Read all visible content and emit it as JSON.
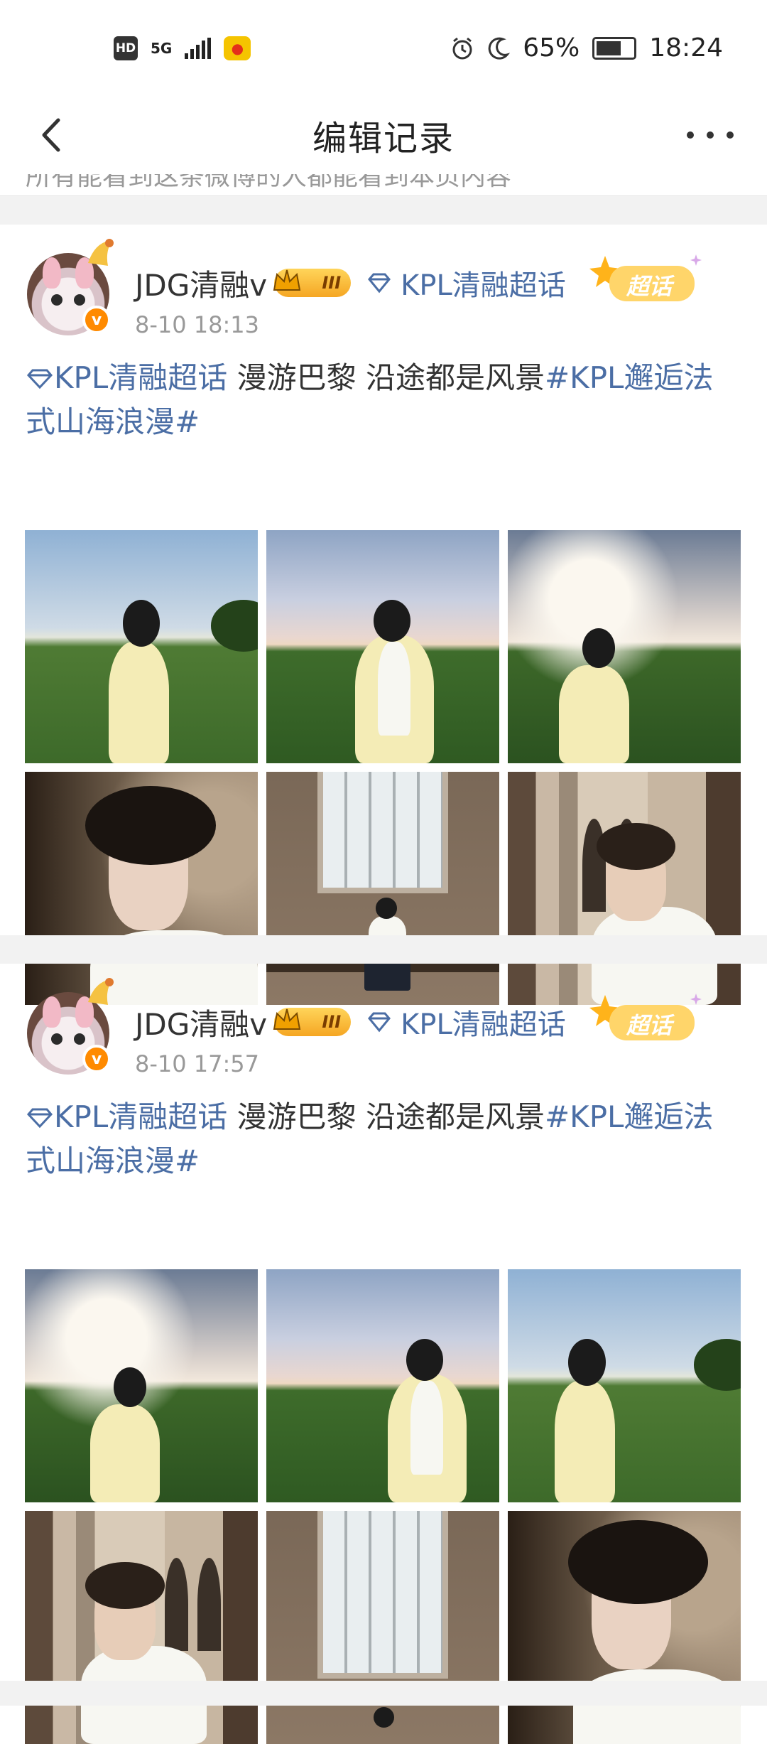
{
  "status": {
    "hd": "HD",
    "network": "5G",
    "battery": "65%",
    "time": "18:24"
  },
  "nav": {
    "title": "编辑记录"
  },
  "banner": {
    "text": "所有能看到这条微博的人都能看到本页内容"
  },
  "posts": [
    {
      "username": "JDG清融v",
      "level": "III",
      "topic": "KPL清融超话",
      "supertopic_badge": "超话",
      "timestamp": "8-10 18:13",
      "text_tag": "KPL清融超话",
      "text_body": " 漫游巴黎 沿途都是风景",
      "text_hashtag": "#KPL邂逅法式山海浪漫#"
    },
    {
      "username": "JDG清融v",
      "level": "III",
      "topic": "KPL清融超话",
      "supertopic_badge": "超话",
      "timestamp": "8-10 17:57",
      "text_tag": "KPL清融超话",
      "text_body": " 漫游巴黎 沿途都是风景",
      "text_hashtag": "#KPL邂逅法式山海浪漫#"
    }
  ],
  "icons": {
    "back": "back-arrow-icon",
    "more": "more-icon",
    "alarm": "alarm-icon",
    "moon": "moon-icon",
    "diamond": "diamond-icon",
    "verified": "verified-badge-icon"
  },
  "colors": {
    "link": "#4b6ea5",
    "muted": "#999999",
    "divider": "#f2f2f2",
    "verified": "#ff8a00"
  }
}
